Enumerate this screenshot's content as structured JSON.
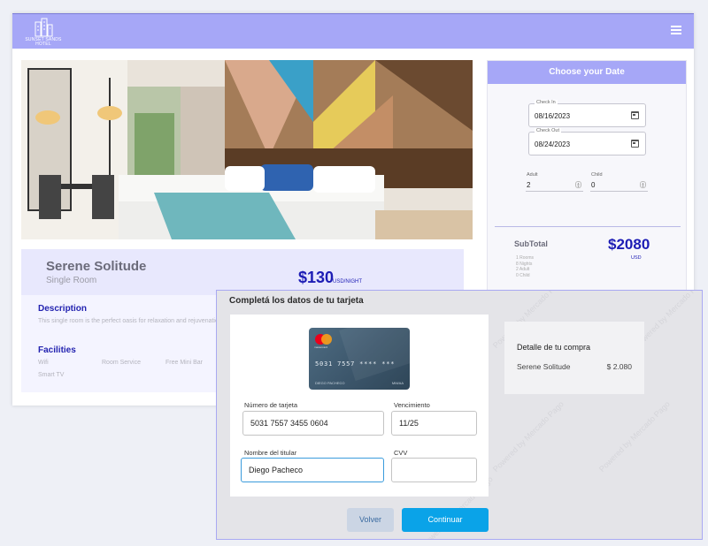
{
  "navbar": {
    "logo_text": "SUNSET SANDS HOTEL",
    "menu_icon": "hamburger-menu-icon",
    "color": "#a6a7f7"
  },
  "room": {
    "name": "Serene Solitude",
    "type": "Single Room",
    "price": "$130",
    "price_unit": "USD/NIGHT",
    "description_title": "Description",
    "description_text": "This single room is the perfect oasis for relaxation and rejuvenation.",
    "facilities_title": "Facilities",
    "facilities": [
      "Wifi",
      "Room Service",
      "Free Mini Bar",
      "Smart TV"
    ]
  },
  "booking": {
    "header": "Choose your Date",
    "check_in_label": "Check In",
    "check_in_value": "08/16/2023",
    "check_out_label": "Check Out",
    "check_out_value": "08/24/2023",
    "adult_label": "Adult",
    "adult_value": "2",
    "child_label": "Child",
    "child_value": "0",
    "subtotal_label": "SubTotal",
    "subtotal_value": "$2080",
    "subtotal_currency": "USD",
    "subtotal_lines": [
      "1 Rooms",
      "8 Nights",
      "2 Adult",
      "0 Child"
    ]
  },
  "payment": {
    "title": "Completá los datos de tu tarjeta",
    "watermark": "Powered by Mercado Pago",
    "card_visual": {
      "brand": "mastercard",
      "number": "5031  7557  ****  ***",
      "holder": "DIEGO PACHECO",
      "expiry": "MM/AA"
    },
    "card_number_label": "Número de tarjeta",
    "card_number_value": "5031 7557 3455 0604",
    "expiry_label": "Vencimiento",
    "expiry_value": "11/25",
    "holder_label": "Nombre del titular",
    "holder_value": "Diego Pacheco",
    "cvv_label": "CVV",
    "cvv_value": "",
    "summary_title": "Detalle de tu compra",
    "summary_item": "Serene Solitude",
    "summary_price": "$ 2.080",
    "back_label": "Volver",
    "continue_label": "Continuar",
    "continue_color": "#0aa3e8"
  }
}
